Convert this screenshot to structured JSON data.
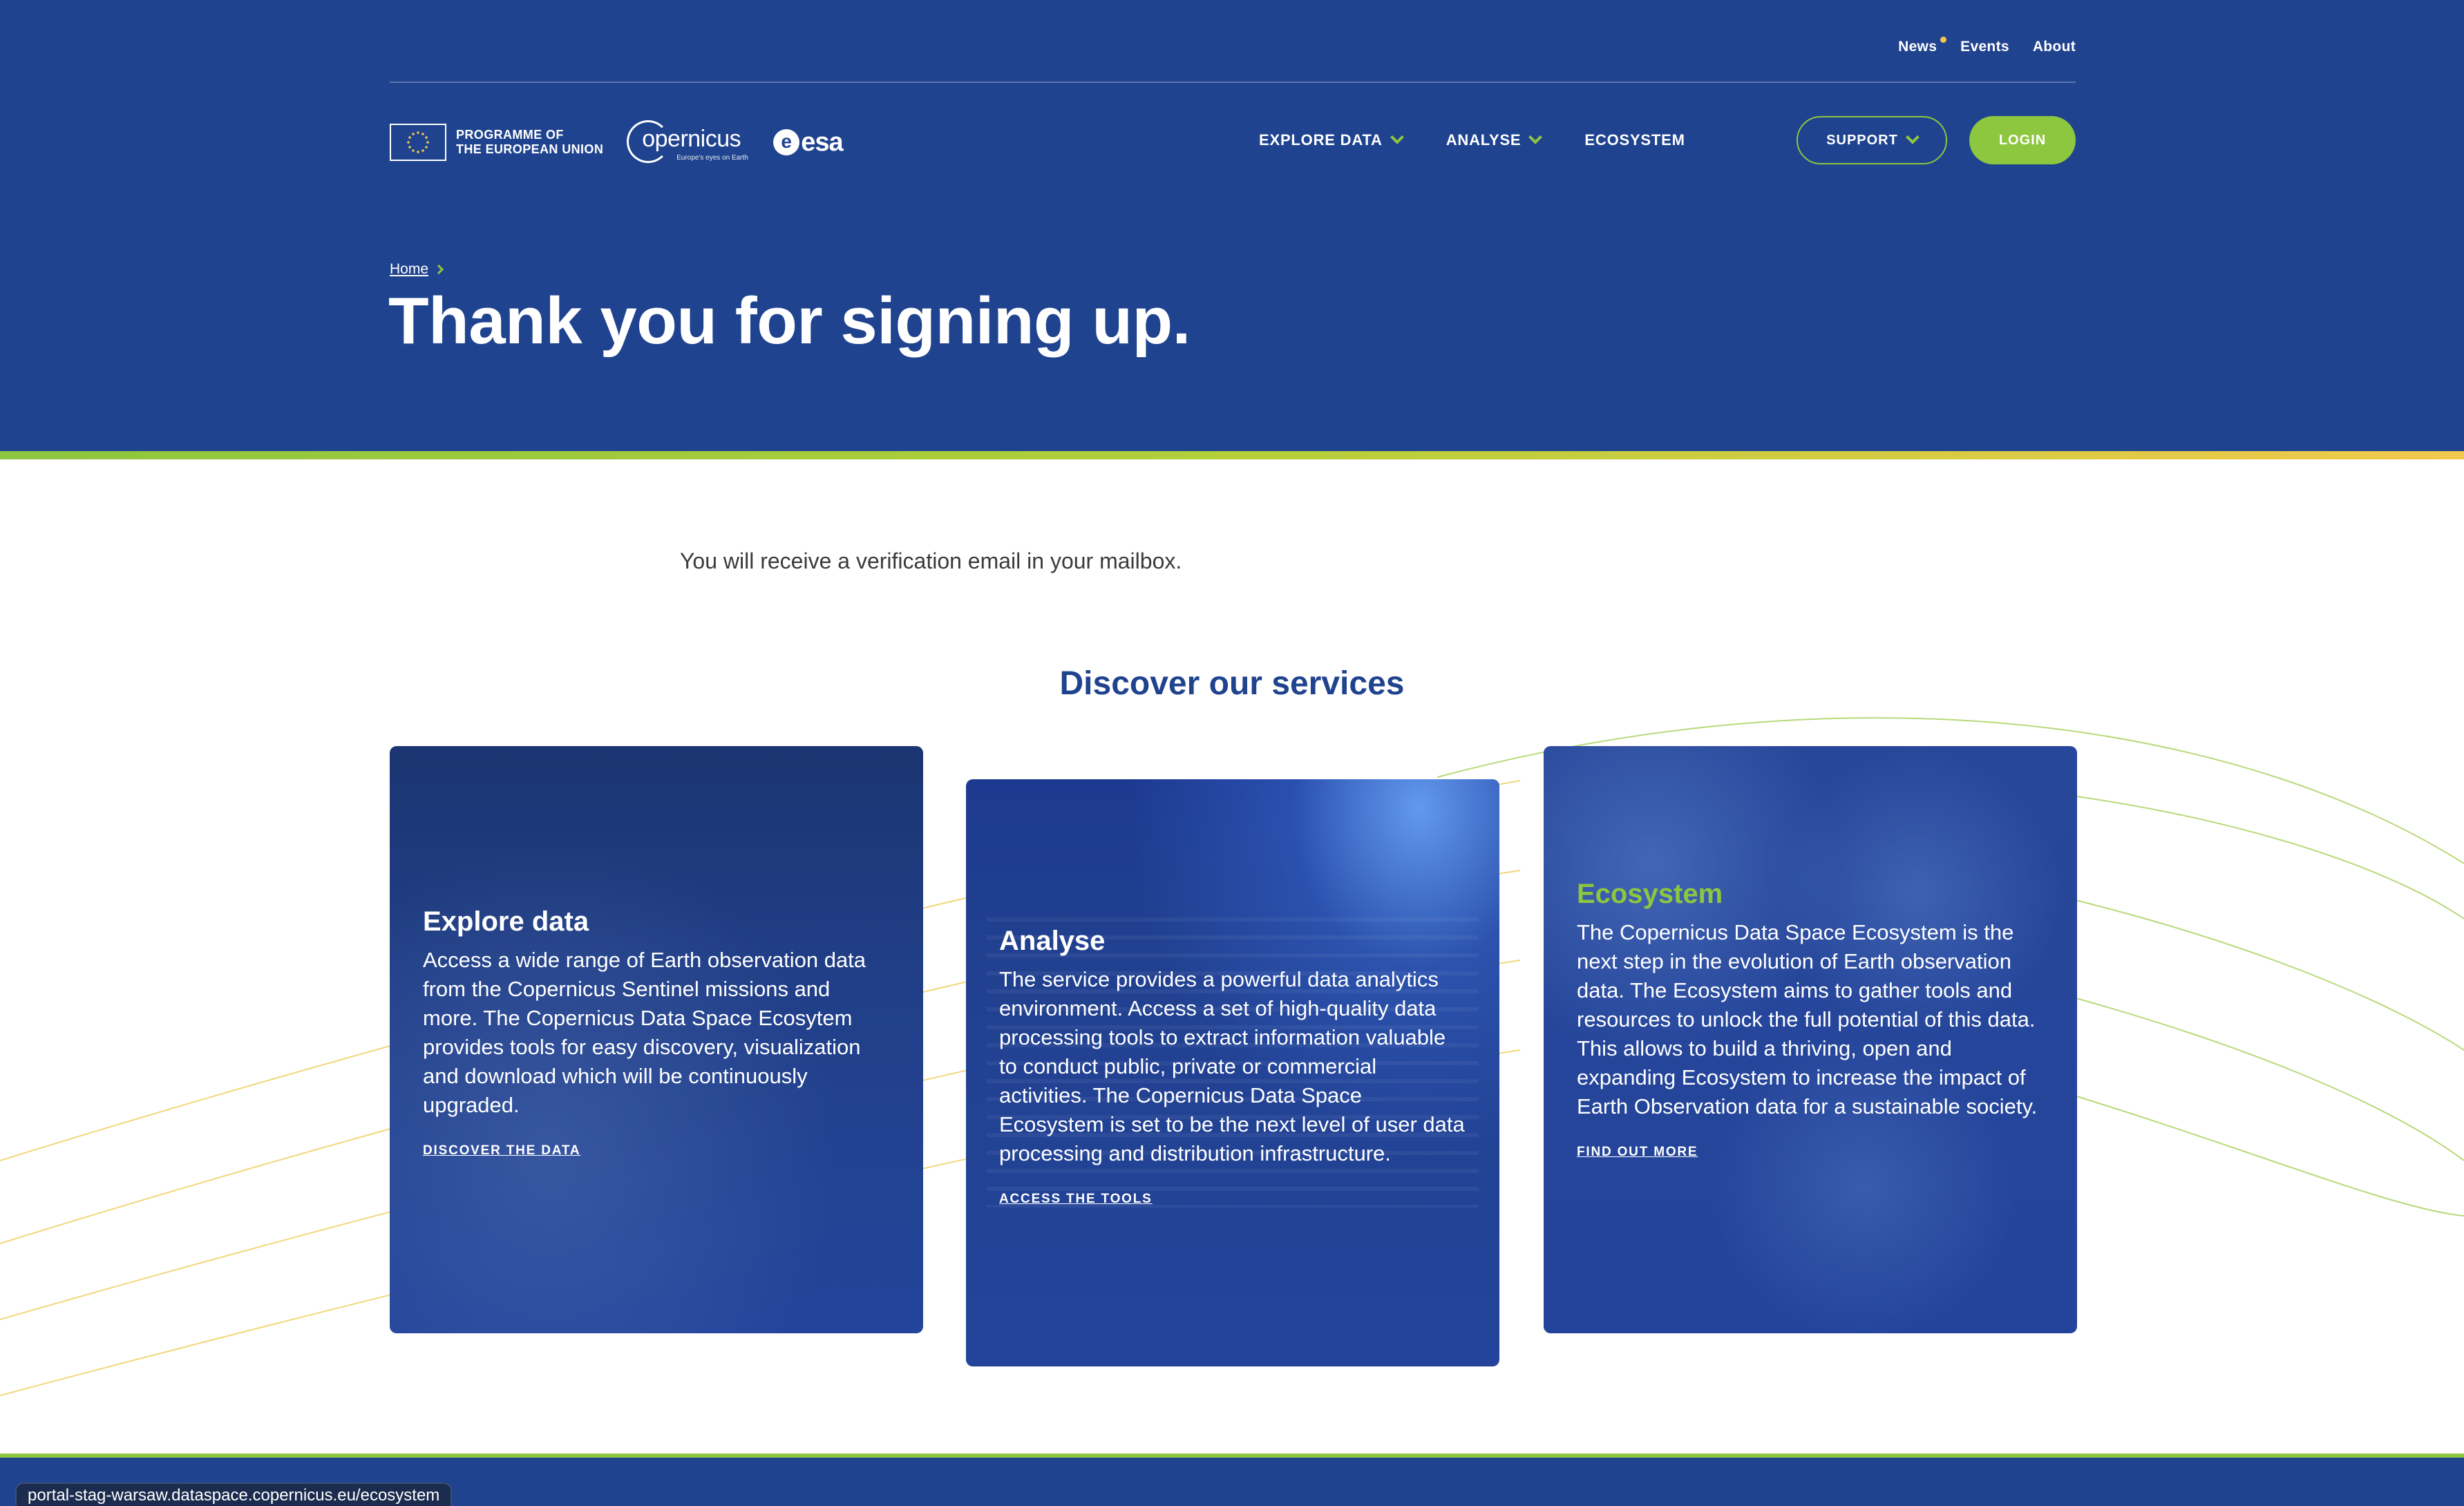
{
  "header": {
    "topnav": [
      {
        "label": "News"
      },
      {
        "label": "Events"
      },
      {
        "label": "About"
      }
    ],
    "eu_program": {
      "line1": "PROGRAMME OF",
      "line2": "THE EUROPEAN UNION"
    },
    "copernicus": {
      "word": "opernicus",
      "tagline": "Europe's eyes on Earth"
    },
    "esa": {
      "letter": "e",
      "word": "esa"
    },
    "mainnav": [
      {
        "label": "EXPLORE DATA"
      },
      {
        "label": "ANALYSE"
      },
      {
        "label": "ECOSYSTEM"
      }
    ],
    "support_label": "SUPPORT",
    "login_label": "LOGIN",
    "breadcrumb_home": "Home",
    "title": "Thank you for signing up."
  },
  "main": {
    "verify_message": "You will receive a verification email in your mailbox.",
    "section_title": "Discover our services",
    "cards": [
      {
        "title": "Explore data",
        "text": "Access a wide range of Earth observation data from the Copernicus Sentinel missions and more. The Copernicus Data Space Ecosytem provides tools for easy discovery, visualization and download which will be continuously upgraded.",
        "cta": "DISCOVER THE DATA"
      },
      {
        "title": "Analyse",
        "text": "The service provides a powerful data analytics environment. Access a set of high-quality data processing tools to extract information valuable to conduct public, private or commercial activities. The Copernicus Data Space Ecosystem is set to be the next level of user data processing and distribution infrastructure.",
        "cta": "ACCESS THE TOOLS"
      },
      {
        "title": "Ecosystem",
        "text": "The Copernicus Data Space Ecosystem is the next step in the evolution of Earth observation data. The Ecosystem aims to gather tools and resources to unlock the full potential of this data. This allows to build a thriving, open and expanding Ecosystem to increase the impact of Earth Observation data for a sustainable society.",
        "cta": "FIND OUT MORE"
      }
    ]
  },
  "status_bar": {
    "url": "portal-stag-warsaw.dataspace.copernicus.eu/ecosystem"
  },
  "colors": {
    "brand_blue": "#1f438f",
    "accent_green": "#8dc63f",
    "accent_yellow": "#f2c94c"
  }
}
